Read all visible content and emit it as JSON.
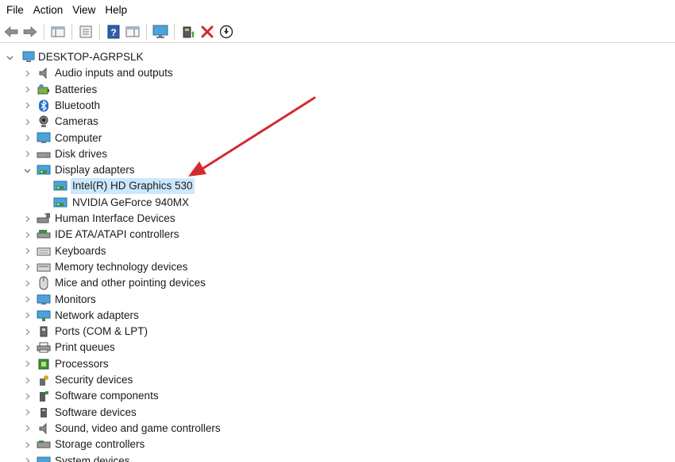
{
  "menu": [
    "File",
    "Action",
    "View",
    "Help"
  ],
  "computer": "DESKTOP-AGRPSLK",
  "categories": [
    {
      "label": "Audio inputs and outputs",
      "icon": "speaker-icon"
    },
    {
      "label": "Batteries",
      "icon": "battery-icon"
    },
    {
      "label": "Bluetooth",
      "icon": "bluetooth-icon"
    },
    {
      "label": "Cameras",
      "icon": "camera-icon"
    },
    {
      "label": "Computer",
      "icon": "computer-icon"
    },
    {
      "label": "Disk drives",
      "icon": "disk-drive-icon"
    },
    {
      "label": "Display adapters",
      "icon": "display-adapter-icon",
      "expanded": true,
      "children": [
        {
          "label": "Intel(R) HD Graphics 530",
          "icon": "display-adapter-icon",
          "selected": true
        },
        {
          "label": "NVIDIA GeForce 940MX",
          "icon": "display-adapter-icon"
        }
      ]
    },
    {
      "label": "Human Interface Devices",
      "icon": "hid-icon"
    },
    {
      "label": "IDE ATA/ATAPI controllers",
      "icon": "ide-controller-icon"
    },
    {
      "label": "Keyboards",
      "icon": "keyboard-icon"
    },
    {
      "label": "Memory technology devices",
      "icon": "memory-icon"
    },
    {
      "label": "Mice and other pointing devices",
      "icon": "mouse-icon"
    },
    {
      "label": "Monitors",
      "icon": "monitor-icon"
    },
    {
      "label": "Network adapters",
      "icon": "network-adapter-icon"
    },
    {
      "label": "Ports (COM & LPT)",
      "icon": "port-icon"
    },
    {
      "label": "Print queues",
      "icon": "printer-icon"
    },
    {
      "label": "Processors",
      "icon": "processor-icon"
    },
    {
      "label": "Security devices",
      "icon": "security-device-icon"
    },
    {
      "label": "Software components",
      "icon": "software-component-icon"
    },
    {
      "label": "Software devices",
      "icon": "software-device-icon"
    },
    {
      "label": "Sound, video and game controllers",
      "icon": "sound-controller-icon"
    },
    {
      "label": "Storage controllers",
      "icon": "storage-controller-icon"
    },
    {
      "label": "System devices",
      "icon": "system-device-icon"
    }
  ],
  "colors": {
    "arrow": "#d42a2f",
    "selection": "#cce8ff",
    "uninstall": "#d62828"
  }
}
